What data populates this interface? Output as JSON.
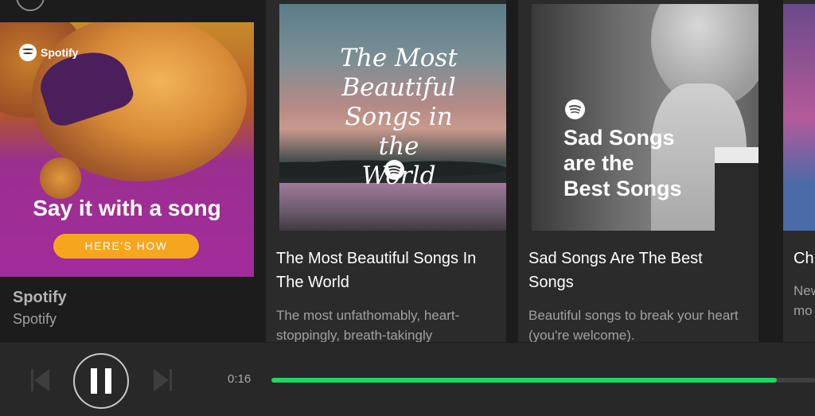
{
  "ad": {
    "brand": "Spotify",
    "headline": "Say it with a song",
    "cta": "HERE'S HOW",
    "title": "Spotify",
    "subtitle": "Spotify"
  },
  "cards": [
    {
      "cover_text": "The Most Beautiful Songs in the World",
      "title": "The Most Beautiful Songs In The World",
      "description": "The most unfathomably, heart-stoppingly, breath-takingly"
    },
    {
      "cover_text": "Sad Songs are the Best Songs",
      "title": "Sad Songs Are The Best Songs",
      "description": "Beautiful songs to break your heart (you're welcome)."
    },
    {
      "title": "Ch",
      "description_line1": "New",
      "description_line2": "mo"
    }
  ],
  "player": {
    "elapsed": "0:16",
    "progress_fraction": 0.93,
    "colors": {
      "progress": "#1ed760",
      "track": "#404040"
    },
    "icons": {
      "prev": "skip-back-icon",
      "play": "pause-icon",
      "next": "skip-forward-icon"
    }
  }
}
